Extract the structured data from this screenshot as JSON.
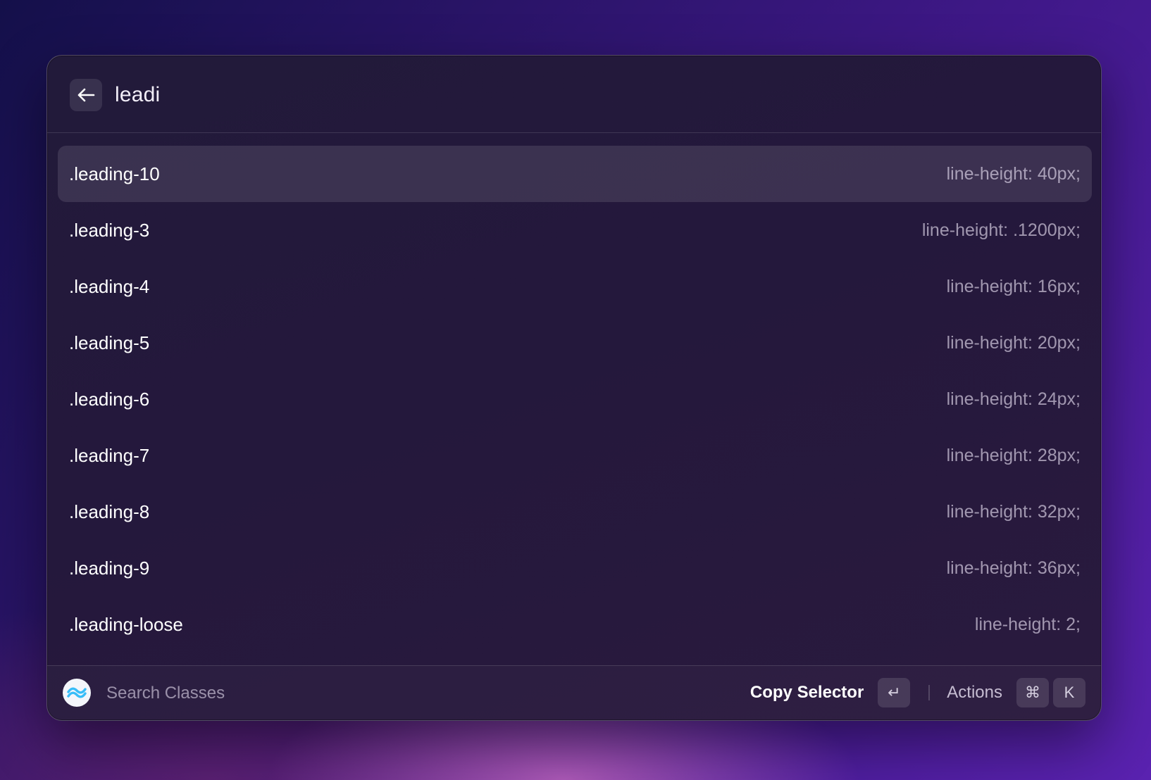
{
  "search": {
    "query": "leadi"
  },
  "results": [
    {
      "name": ".leading-10",
      "value": "line-height: 40px;",
      "selected": true
    },
    {
      "name": ".leading-3",
      "value": "line-height: .1200px;",
      "selected": false
    },
    {
      "name": ".leading-4",
      "value": "line-height: 16px;",
      "selected": false
    },
    {
      "name": ".leading-5",
      "value": "line-height: 20px;",
      "selected": false
    },
    {
      "name": ".leading-6",
      "value": "line-height: 24px;",
      "selected": false
    },
    {
      "name": ".leading-7",
      "value": "line-height: 28px;",
      "selected": false
    },
    {
      "name": ".leading-8",
      "value": "line-height: 32px;",
      "selected": false
    },
    {
      "name": ".leading-9",
      "value": "line-height: 36px;",
      "selected": false
    },
    {
      "name": ".leading-loose",
      "value": "line-height: 2;",
      "selected": false
    }
  ],
  "footer": {
    "title": "Search Classes",
    "primary_action": "Copy Selector",
    "primary_key": "↵",
    "secondary_action": "Actions",
    "secondary_keys": [
      "⌘",
      "K"
    ]
  },
  "icons": {
    "back": "arrow-left-icon",
    "logo": "tailwind-logo-icon"
  },
  "colors": {
    "accent_logo": "#38bdf8",
    "selected_row": "#3a3050"
  }
}
